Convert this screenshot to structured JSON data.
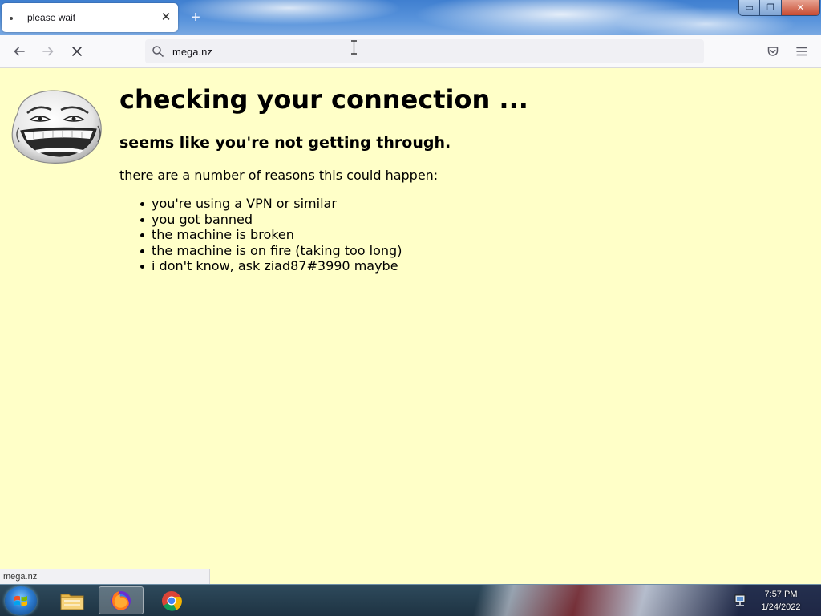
{
  "browser": {
    "tab": {
      "title": "please wait"
    },
    "new_tab_symbol": "+",
    "window_controls": {
      "minimize": "▭",
      "maximize": "❐",
      "close": "✕"
    },
    "url": "mega.nz",
    "status_url": "mega.nz"
  },
  "page": {
    "heading": "checking your connection ...",
    "subheading": "seems like you're not getting through.",
    "intro": "there are a number of reasons this could happen:",
    "reasons": [
      "you're using a VPN or similar",
      "you got banned",
      "the machine is broken",
      "the machine is on fire (taking too long)",
      "i don't know, ask ziad87#3990 maybe"
    ],
    "image_icon": "troll-face-icon",
    "background_color": "#ffffc8"
  },
  "taskbar": {
    "apps": [
      "windows-explorer-icon",
      "firefox-icon",
      "chrome-icon"
    ],
    "clock": {
      "time": "7:57 PM",
      "date": "1/24/2022"
    }
  }
}
